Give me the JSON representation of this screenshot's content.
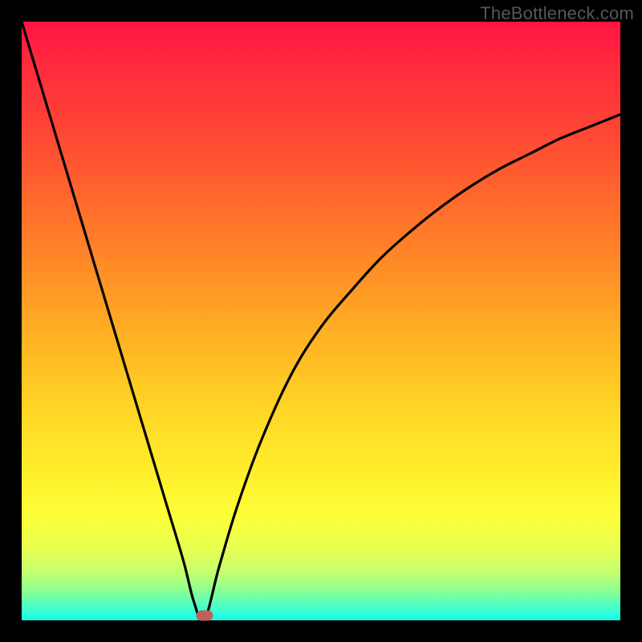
{
  "watermark": "TheBottleneck.com",
  "chart_data": {
    "type": "line",
    "title": "",
    "xlabel": "",
    "ylabel": "",
    "xlim": [
      0,
      100
    ],
    "ylim": [
      0,
      100
    ],
    "series": [
      {
        "name": "curve",
        "x": [
          0,
          3,
          6,
          9,
          12,
          15,
          18,
          21,
          24,
          27,
          28.8,
          30.5,
          33,
          36,
          40,
          45,
          50,
          55,
          60,
          65,
          70,
          75,
          80,
          85,
          90,
          95,
          100
        ],
        "values": [
          100,
          90,
          80,
          70,
          60,
          50,
          40,
          30,
          20,
          10,
          3,
          0,
          9,
          19,
          30,
          41,
          49,
          55,
          60.5,
          65,
          69,
          72.5,
          75.5,
          78,
          80.5,
          82.5,
          84.5
        ]
      }
    ],
    "marker": {
      "x": 30.5,
      "y": 0.8
    },
    "background_gradient": {
      "top": "#ff1440",
      "mid1": "#ff8f26",
      "mid2": "#fff02c",
      "bottom": "#1cf7e2"
    }
  }
}
